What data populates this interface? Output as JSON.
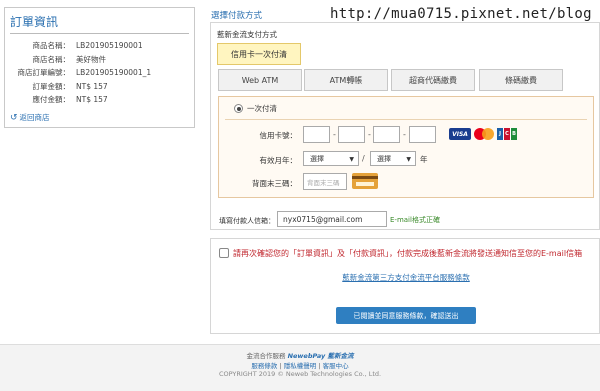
{
  "watermark": "http://mua0715.pixnet.net/blog",
  "order": {
    "title": "訂單資訊",
    "rows": [
      {
        "k": "商品名稱：",
        "v": "LB201905190001"
      },
      {
        "k": "商店名稱：",
        "v": "美好物件"
      },
      {
        "k": "商店訂單編號：",
        "v": "LB201905190001_1"
      },
      {
        "k": "訂單金額：",
        "v": "NT$ 157"
      },
      {
        "k": "應付金額：",
        "v": "NT$ 157"
      }
    ],
    "back_label": "返回商店"
  },
  "payment": {
    "heading": "選擇付款方式",
    "box_title": "藍新金流支付方式",
    "tabs": {
      "credit": "信用卡一次付清",
      "webatm": "Web ATM",
      "atm": "ATM轉帳",
      "cvs": "超商代碼繳費",
      "barcode": "條碼繳費"
    },
    "one_time": "一次付清",
    "card_number_label": "信用卡號：",
    "expiry_label": "有效月年：",
    "month_placeholder": "選擇",
    "year_placeholder": "選擇",
    "year_suffix": "年",
    "cvv_label": "背面末三碼：",
    "cvv_placeholder": "背面末三碼",
    "brands": {
      "visa": "VISA",
      "mc": "MasterCard",
      "jcb": [
        "J",
        "C",
        "B"
      ]
    },
    "email_label": "填寫付款人信箱：",
    "email_value": "nyx0715@gmail.com",
    "email_hint": "E-mail格式正確"
  },
  "confirm": {
    "text": "請再次確認您的「訂單資訊」及「付款資訊」，付款完成後藍新金流將發送通知信至您的E-mail信箱",
    "terms_link": "藍新金流第三方支付金流平台服務條款",
    "submit": "已閱讀並同意服務條款，確認送出"
  },
  "footer": {
    "provider_prefix": "金流合作服務",
    "provider_logo": "NewebPay 藍新金流",
    "links": [
      "服務條款",
      "隱私權聲明",
      "客服中心"
    ],
    "copyright": "COPYRIGHT 2019 © Neweb Technologies Co., Ltd."
  }
}
